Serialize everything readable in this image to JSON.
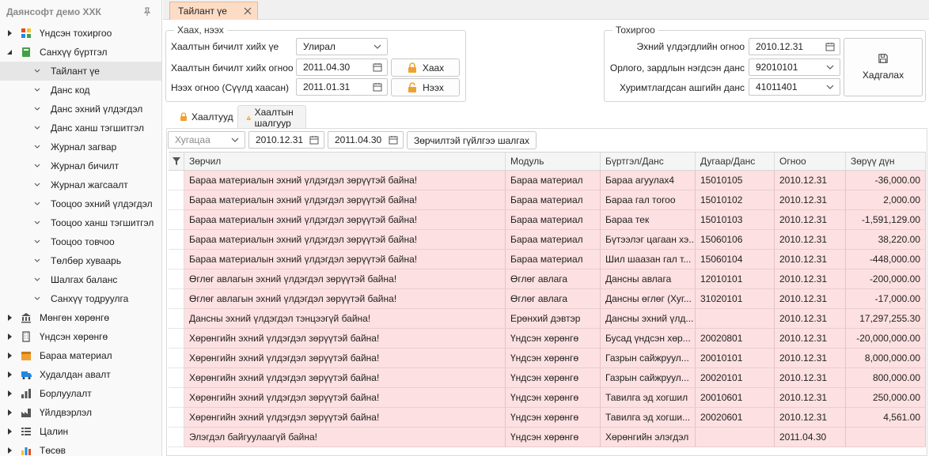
{
  "sidebar": {
    "app_title": "Даянсофт демо ХХК",
    "categories_top": [
      {
        "label": "Үндсэн тохиргоо",
        "icon": "grid-icon",
        "color": "#e64a19"
      },
      {
        "label": "Санхүү бүртгэл",
        "icon": "book-icon",
        "color": "#43a047"
      }
    ],
    "children": [
      "Тайлант үе",
      "Данс код",
      "Данс эхний үлдэгдэл",
      "Данс ханш тэгшитгэл",
      "Журнал загвар",
      "Журнал бичилт",
      "Журнал жагсаалт",
      "Тооцоо эхний үлдэгдэл",
      "Тооцоо ханш тэгшитгэл",
      "Тооцоо товчоо",
      "Төлбөр хуваарь",
      "Шалгах баланс",
      "Санхүү тодруулга"
    ],
    "categories_bottom": [
      {
        "label": "Мөнгөн хөрөнгө",
        "icon": "bank-icon",
        "color": "#555555"
      },
      {
        "label": "Үндсэн хөрөнгө",
        "icon": "building-icon",
        "color": "#555555"
      },
      {
        "label": "Бараа материал",
        "icon": "box-icon",
        "color": "#f0a030"
      },
      {
        "label": "Худалдан авалт",
        "icon": "truck-icon",
        "color": "#1e88e5"
      },
      {
        "label": "Борлуулалт",
        "icon": "barchart-icon",
        "color": "#555555"
      },
      {
        "label": "Үйлдвэрлэл",
        "icon": "factory-icon",
        "color": "#555555"
      },
      {
        "label": "Цалин",
        "icon": "list-icon",
        "color": "#555555"
      },
      {
        "label": "Төсөв",
        "icon": "chart-icon",
        "color": "#1e88e5"
      }
    ]
  },
  "tab": {
    "title": "Тайлант үе"
  },
  "close_group": {
    "legend": "Хаах, нээх",
    "period_type_label": "Хаалтын бичилт хийх үе",
    "period_type_value": "Улирал",
    "close_date_label": "Хаалтын бичилт хийх огноо",
    "close_date_value": "2011.04.30",
    "open_date_label": "Нээх огноо (Сүүлд хаасан)",
    "open_date_value": "2011.01.31",
    "close_button": "Хаах",
    "open_button": "Нээх"
  },
  "settings_group": {
    "legend": "Тохиргоо",
    "opening_date_label": "Эхний үлдэгдлийн огноо",
    "opening_date_value": "2010.12.31",
    "income_account_label": "Орлого, зардлын нэгдсэн данс",
    "income_account_value": "92010101",
    "retained_account_label": "Хуримтлагдсан ашгийн данс",
    "retained_account_value": "41011401",
    "save_button": "Хадгалах"
  },
  "inner_tabs": {
    "closings": "Хаалтууд",
    "checks": "Хаалтын шалгуур"
  },
  "filter": {
    "period_placeholder": "Хугацаа",
    "from_date": "2010.12.31",
    "to_date": "2011.04.30",
    "check_button": "Зөрчилтэй гүйлгээ шалгах"
  },
  "grid": {
    "columns": [
      "Зөрчил",
      "Модуль",
      "Бүртгэл/Данс",
      "Дугаар/Данс",
      "Огноо",
      "Зөрүү дүн"
    ],
    "rows": [
      [
        "Бараа материалын эхний үлдэгдэл зөрүүтэй байна!",
        "Бараа материал",
        "Бараа агуулах4",
        "15010105",
        "2010.12.31",
        "-36,000.00"
      ],
      [
        "Бараа материалын эхний үлдэгдэл зөрүүтэй байна!",
        "Бараа материал",
        "Бараа гал тогоо",
        "15010102",
        "2010.12.31",
        "2,000.00"
      ],
      [
        "Бараа материалын эхний үлдэгдэл зөрүүтэй байна!",
        "Бараа материал",
        "Бараа тек",
        "15010103",
        "2010.12.31",
        "-1,591,129.00"
      ],
      [
        "Бараа материалын эхний үлдэгдэл зөрүүтэй байна!",
        "Бараа материал",
        "Бүтээлэг цагаан хэ...",
        "15060106",
        "2010.12.31",
        "38,220.00"
      ],
      [
        "Бараа материалын эхний үлдэгдэл зөрүүтэй байна!",
        "Бараа материал",
        "Шил шаазан гал т...",
        "15060104",
        "2010.12.31",
        "-448,000.00"
      ],
      [
        "Өглөг авлагын эхний үлдэгдэл зөрүүтэй байна!",
        "Өглөг авлага",
        "Дансны авлага",
        "12010101",
        "2010.12.31",
        "-200,000.00"
      ],
      [
        "Өглөг авлагын эхний үлдэгдэл зөрүүтэй байна!",
        "Өглөг авлага",
        "Дансны өглөг (Хуг...",
        "31020101",
        "2010.12.31",
        "-17,000.00"
      ],
      [
        "Дансны эхний үлдэгдэл тэнцээгүй байна!",
        "Ерөнхий дэвтэр",
        "Дансны эхний үлд...",
        "",
        "2010.12.31",
        "17,297,255.30"
      ],
      [
        "Хөрөнгийн эхний үлдэгдэл зөрүүтэй байна!",
        "Үндсэн хөрөнгө",
        "Бусад үндсэн хөр...",
        "20020801",
        "2010.12.31",
        "-20,000,000.00"
      ],
      [
        "Хөрөнгийн эхний үлдэгдэл зөрүүтэй байна!",
        "Үндсэн хөрөнгө",
        "Газрын сайжруул...",
        "20010101",
        "2010.12.31",
        "8,000,000.00"
      ],
      [
        "Хөрөнгийн эхний үлдэгдэл зөрүүтэй байна!",
        "Үндсэн хөрөнгө",
        "Газрын сайжруул...",
        "20020101",
        "2010.12.31",
        "800,000.00"
      ],
      [
        "Хөрөнгийн эхний үлдэгдэл зөрүүтэй байна!",
        "Үндсэн хөрөнгө",
        "Тавилга эд хогшил",
        "20010601",
        "2010.12.31",
        "250,000.00"
      ],
      [
        "Хөрөнгийн эхний үлдэгдэл зөрүүтэй байна!",
        "Үндсэн хөрөнгө",
        "Тавилга эд хогши...",
        "20020601",
        "2010.12.31",
        "4,561.00"
      ],
      [
        "Элэгдэл байгуулаагүй байна!",
        "Үндсэн хөрөнгө",
        "Хөрөнгийн элэгдэл",
        "",
        "2011.04.30",
        ""
      ]
    ]
  }
}
